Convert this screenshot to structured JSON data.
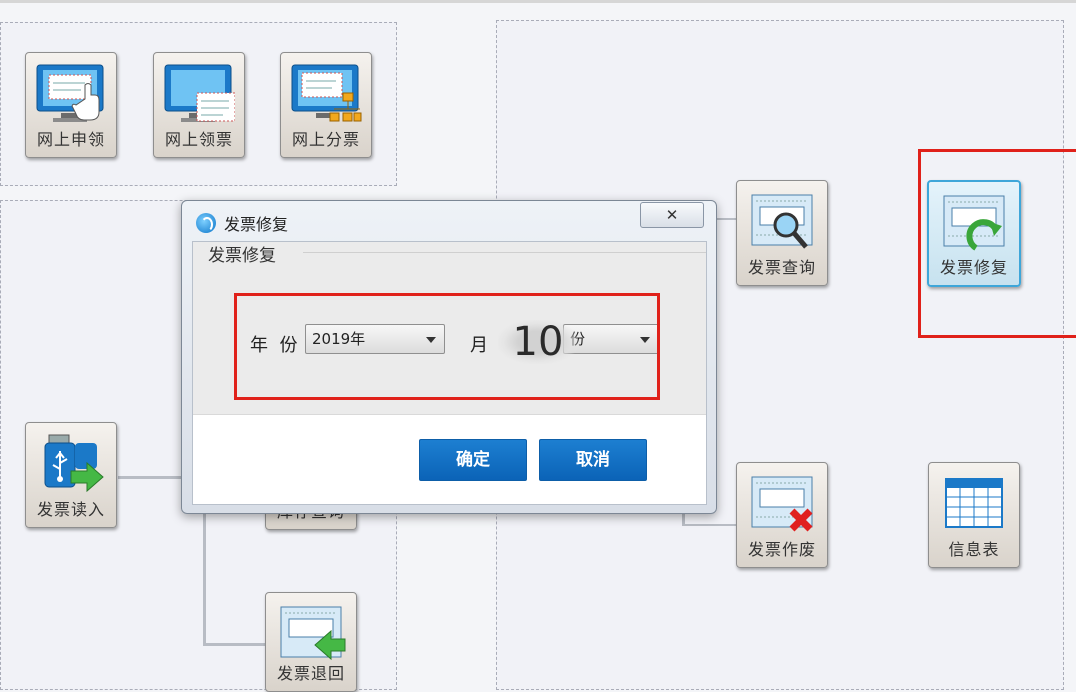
{
  "tiles": {
    "online_apply": "网上申领",
    "online_receive": "网上领票",
    "online_distribute": "网上分票",
    "invoice_query": "发票查询",
    "invoice_repair": "发票修复",
    "invoice_read": "发票读入",
    "stock_query": "库存查询",
    "invoice_void": "发票作废",
    "info_table": "信息表",
    "invoice_return": "发票退回"
  },
  "dialog": {
    "title": "发票修复",
    "close": "✕",
    "group_title": "发票修复",
    "year_label": "年  份",
    "year_value": "2019年",
    "month_label": "月",
    "month_value": "10",
    "month_suffix": "份",
    "ok": "确定",
    "cancel": "取消"
  },
  "colors": {
    "highlight": "#e0211a",
    "button": "#0b63b7",
    "selected_tile": "#3ea6d9"
  }
}
